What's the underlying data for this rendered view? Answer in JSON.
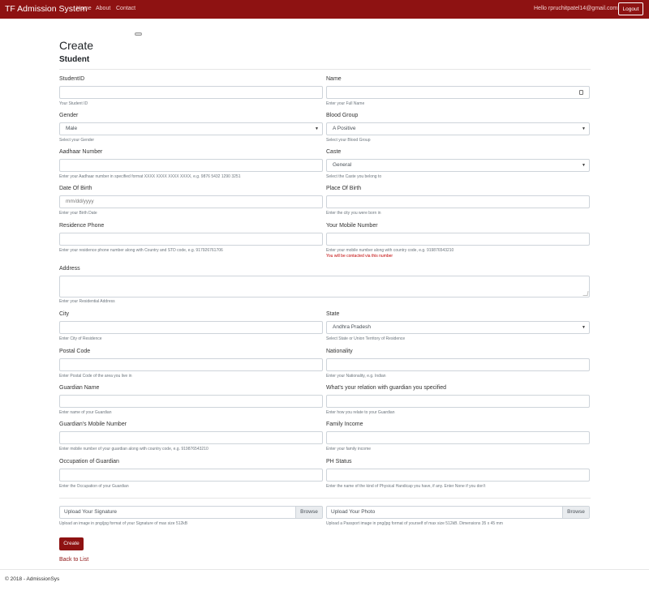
{
  "navbar": {
    "brand": "TF Admission System",
    "links": [
      "Home",
      "About",
      "Contact"
    ],
    "greeting": "Hello rpruchitpatel14@gmail.com!",
    "logout_label": "Logout"
  },
  "page": {
    "title": "Create",
    "subtitle": "Student"
  },
  "fields": {
    "student_id": {
      "label": "StudentID",
      "value": "",
      "help": "Your Student ID"
    },
    "name": {
      "label": "Name",
      "value": "",
      "help": "Enter your Full Name"
    },
    "gender": {
      "label": "Gender",
      "value": "Male",
      "help": "Select your Gender"
    },
    "blood_group": {
      "label": "Blood Group",
      "value": "A Positive",
      "help": "Select your Blood Group"
    },
    "aadhaar": {
      "label": "Aadhaar Number",
      "value": "",
      "help": "Enter your Aadhaar number in specified format XXXX XXXX XXXX XXXX, e.g. 9876 5432 1290 3251"
    },
    "caste": {
      "label": "Caste",
      "value": "General",
      "help": "Select the Caste you belong to"
    },
    "dob": {
      "label": "Date Of Birth",
      "placeholder": "mm/dd/yyyy",
      "help": "Enter your Birth Date"
    },
    "place_of_birth": {
      "label": "Place Of Birth",
      "value": "",
      "help": "Enter the city you were born in"
    },
    "residence_phone": {
      "label": "Residence Phone",
      "value": "",
      "help": "Enter your residence phone number along with Country and STD code, e.g. 917926761706"
    },
    "mobile": {
      "label": "Your Mobile Number",
      "value": "",
      "help": "Enter your mobile number along with country code, e.g. 919876543210",
      "warning": "You will be contacted via this number"
    },
    "address": {
      "label": "Address",
      "value": "",
      "help": "Enter your Residential Address"
    },
    "city": {
      "label": "City",
      "value": "",
      "help": "Enter City of Residence"
    },
    "state": {
      "label": "State",
      "value": "Andhra Pradesh",
      "help": "Select State or Union Territory of Residence"
    },
    "postal_code": {
      "label": "Postal Code",
      "value": "",
      "help": "Enter Postal Code of the area you live in"
    },
    "nationality": {
      "label": "Nationality",
      "value": "",
      "help": "Enter your Nationality, e.g. Indian"
    },
    "guardian_name": {
      "label": "Guardian Name",
      "value": "",
      "help": "Enter name of your Guardian"
    },
    "guardian_relation": {
      "label": "What's your relation with guardian you specified",
      "value": "",
      "help": "Enter how you relate to your Guardian"
    },
    "guardian_mobile": {
      "label": "Guardian's Mobile Number",
      "value": "",
      "help": "Enter mobile number of your guardian along with country code, e.g. 919876543210"
    },
    "family_income": {
      "label": "Family Income",
      "value": "",
      "help": "Enter your family income"
    },
    "guardian_occupation": {
      "label": "Occupation of Guardian",
      "value": "",
      "help": "Enter the Occupation of your Guardian"
    },
    "ph_status": {
      "label": "PH Status",
      "value": "",
      "help": "Enter the name of the kind of Physical Handicap you have, if any. Enter None if you don't"
    }
  },
  "uploads": {
    "browse_label": "Browse",
    "signature": {
      "label": "Upload Your Signature",
      "help": "Upload an image in png/jpg format of your Signature of max size 512kB"
    },
    "photo": {
      "label": "Upload Your Photo",
      "help": "Upload a Passport image in png/jpg format of yourself of max size 512kB. Dimensions 35 x 45 mm"
    }
  },
  "actions": {
    "create_label": "Create",
    "back_label": "Back to List"
  },
  "footer": {
    "text": "© 2018 - AdmissionSys"
  },
  "colors": {
    "brand": "#8e1212",
    "warning": "#c00000"
  },
  "icons": {
    "select_caret": "▼",
    "id_card": "contact-card-icon"
  }
}
